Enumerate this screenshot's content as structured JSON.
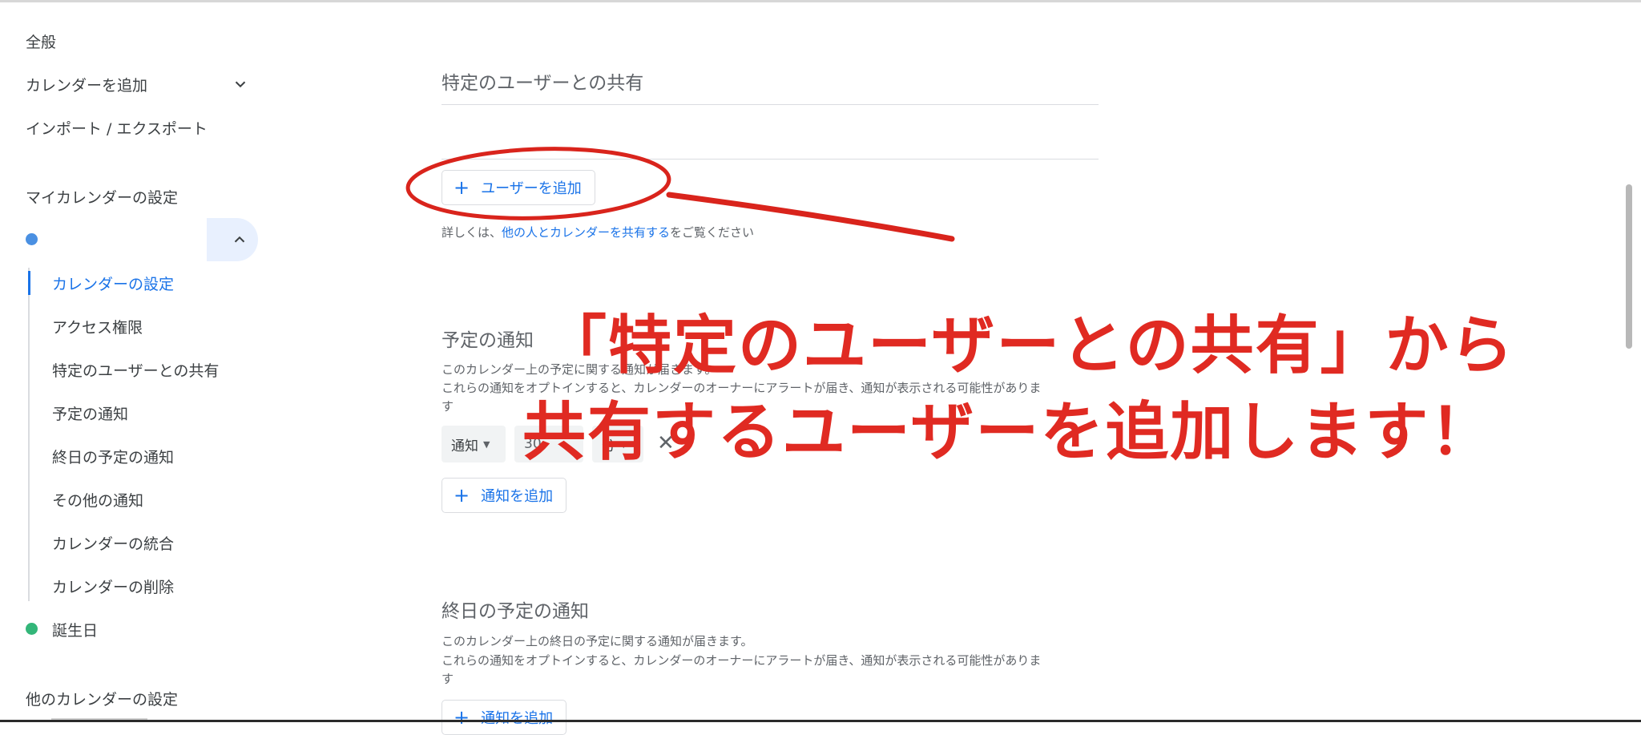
{
  "sidebar": {
    "general": "全般",
    "add_calendar": "カレンダーを追加",
    "import_export": "インポート / エクスポート",
    "my_calendars_heading": "マイカレンダーの設定",
    "sub_items": [
      "カレンダーの設定",
      "アクセス権限",
      "特定のユーザーとの共有",
      "予定の通知",
      "終日の予定の通知",
      "その他の通知",
      "カレンダーの統合",
      "カレンダーの削除"
    ],
    "birthday": "誕生日",
    "other_calendars_heading": "他のカレンダーの設定"
  },
  "main": {
    "share_section": {
      "title": "特定のユーザーとの共有",
      "add_user_button": "ユーザーを追加",
      "help_prefix": "詳しくは、",
      "help_link": "他の人とカレンダーを共有する",
      "help_suffix": "をご覧ください"
    },
    "event_notifications": {
      "title": "予定の通知",
      "desc1": "このカレンダー上の予定に関する通知が届きます。",
      "desc2": "これらの通知をオプトインすると、カレンダーのオーナーにアラートが届き、通知が表示される可能性がありま",
      "desc3": "す",
      "type_select": "通知",
      "amount": "30",
      "unit_select": "分",
      "add_notification_button": "通知を追加"
    },
    "allday_notifications": {
      "title": "終日の予定の通知",
      "desc1": "このカレンダー上の終日の予定に関する通知が届きます。",
      "desc2": "これらの通知をオプトインすると、カレンダーのオーナーにアラートが届き、通知が表示される可能性がありま",
      "desc3": "す",
      "add_notification_button": "通知を追加"
    }
  },
  "annotation": {
    "line1": "「特定のユーザーとの共有」から",
    "line2": "共有するユーザーを追加します！",
    "color": "#e02a22"
  },
  "colors": {
    "accent": "#1a73e8",
    "calendar_dot": "#4a90e2",
    "birthday_dot": "#33b679"
  }
}
